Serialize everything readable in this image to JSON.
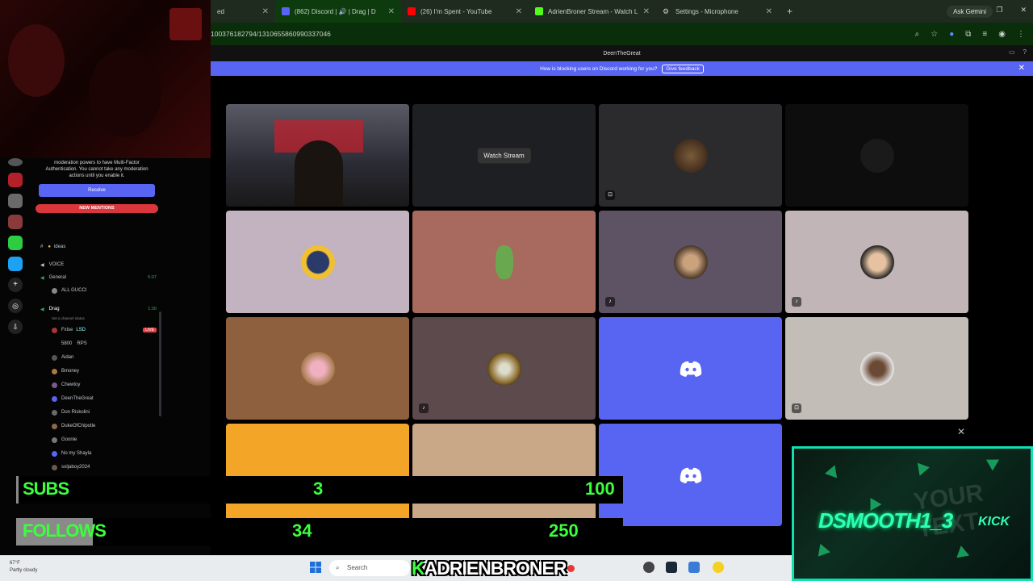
{
  "browser": {
    "tabs": [
      {
        "title": "ed",
        "active": false
      },
      {
        "title": "(862) Discord | 🔊 | Drag | D",
        "active": true
      },
      {
        "title": "(26) I'm Spent - YouTube",
        "active": false
      },
      {
        "title": "AdrienBroner Stream - Watch L",
        "active": false
      },
      {
        "title": "Settings - Microphone",
        "active": false
      }
    ],
    "new_tab": "+",
    "ask_gemini": "Ask Gemini",
    "url": "100376182794/1310655860990337046"
  },
  "discord": {
    "title": "DeenTheGreat",
    "banner_text": "How is blocking users on Discord working for you?",
    "banner_button": "Give feedback",
    "watch_stream": "Watch Stream",
    "mfa_text": "moderation powers to have Multi-Factor Authentication. You cannot take any moderation actions until you enable it.",
    "resolve": "Resolve",
    "new_mentions": "NEW MENTIONS",
    "channels": {
      "ideas": "ideas",
      "voice_category": "VOICE",
      "general": "General",
      "general_time": "5:07",
      "general_user": "ALL GUCCI",
      "drag": "Drag",
      "drag_time": "1:30",
      "drag_status": "Set a channel status",
      "live": "LIVE"
    },
    "members": [
      "Fxlse",
      "5800",
      "Aidan",
      "Bmoney",
      "Chewtoy",
      "DeenTheGreat",
      "Don Riskolini",
      "DukeOfChipotle",
      "Goonie",
      "No my Shayla",
      "soljaboy2024"
    ],
    "member_tags": {
      "fxlse": "LSD",
      "5800": "RPS"
    }
  },
  "overlay": {
    "subs_label": "SUBS",
    "subs_current": "3",
    "subs_goal": "100",
    "follows_label": "FOLLOWS",
    "follows_current": "34",
    "follows_goal": "250",
    "kick_prefix": "K",
    "kick_channel": "ADRIENBRONER",
    "kick_card_name": "DSMOOTH1_3",
    "kick_card_tag": "KICK",
    "kick_card_ghost": "YOUR TEXT"
  },
  "taskbar": {
    "weather_temp": "67°F",
    "weather_desc": "Partly cloudy",
    "search": "Search"
  },
  "colors": {
    "blurple": "#5865f2",
    "green": "#3cff3c",
    "kick": "#2fffb5"
  }
}
